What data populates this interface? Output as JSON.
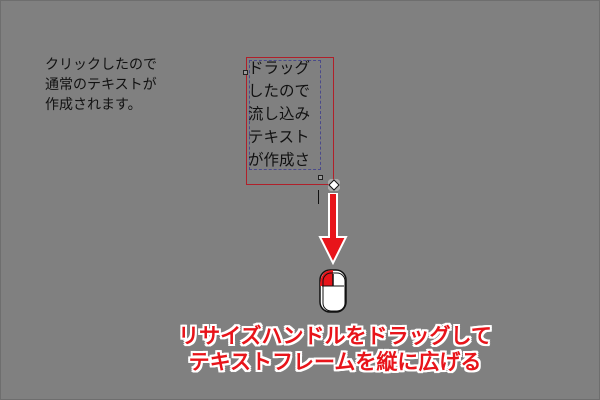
{
  "point_text": {
    "lines": [
      "クリックしたので",
      "通常のテキストが",
      "作成されます。"
    ]
  },
  "area_text": {
    "lines": [
      "ドラッグ",
      "したので",
      "流し込み",
      "テキスト",
      "が作成さ"
    ]
  },
  "caption": {
    "line1": "リサイズハンドルをドラッグして",
    "line2": "テキストフレームを縦に広げる"
  },
  "colors": {
    "background": "#808080",
    "frame_border": "#b0202a",
    "arrow": "#e8141a",
    "caption": "#e8141a"
  },
  "icons": [
    "resize-handle-icon",
    "down-arrow-icon",
    "mouse-icon"
  ]
}
